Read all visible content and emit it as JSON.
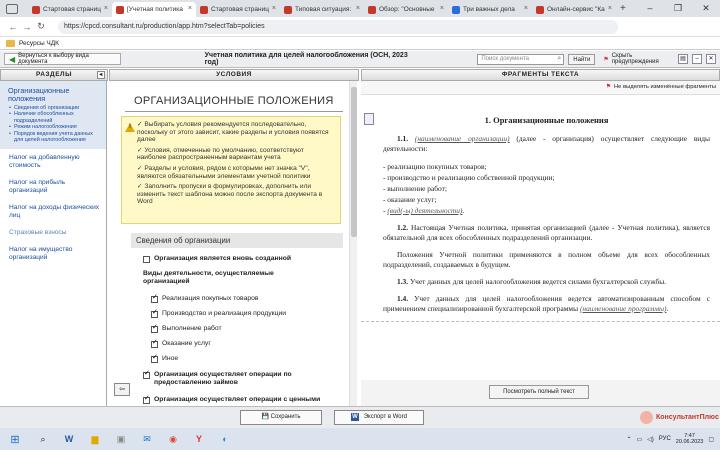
{
  "browser": {
    "tabs": [
      {
        "title": "Стартовая страниц",
        "color": "#c0392b",
        "active": false
      },
      {
        "title": "[Учетная политика",
        "color": "#c0392b",
        "active": true
      },
      {
        "title": "Стартовая страниц",
        "color": "#c0392b",
        "active": false
      },
      {
        "title": "Типовая ситуация:",
        "color": "#c0392b",
        "active": false
      },
      {
        "title": "Обзор: \"Основные",
        "color": "#c0392b",
        "active": false
      },
      {
        "title": "Три важных дела",
        "color": "#2b6cd6",
        "active": false
      },
      {
        "title": "Онлайн-сервис \"Ка",
        "color": "#c0392b",
        "active": false
      }
    ],
    "new_tab": "+",
    "url": "https://cpcd.consultant.ru/production/app.htm?selectTab=policies",
    "bookmark_folder": "Ресурсы ЧДК"
  },
  "toolbar": {
    "back_button": "Вернуться к выбору вида документа",
    "doc_title": "Учетная политика для целей налогообложения (ОСН, 2023 год)",
    "search_placeholder": "Поиск документа",
    "find_button": "Найти",
    "hide_warnings": "Скрыть предупреждения"
  },
  "panels": {
    "left_header": "РАЗДЕЛЫ",
    "mid_header": "УСЛОВИЯ",
    "right_header": "ФРАГМЕНТЫ ТЕКСТА"
  },
  "sections": {
    "selected": "Организационные положения",
    "subitems": [
      "Сведения об организации",
      "Наличие обособленных подразделений",
      "Режим налогообложения",
      "Порядок ведения учета данных для целей налогообложения"
    ],
    "items": [
      {
        "label": "Налог на добавленную стоимость",
        "gray": false
      },
      {
        "label": "Налог на прибыль организаций",
        "gray": false
      },
      {
        "label": "Налог на доходы физических лиц",
        "gray": false
      },
      {
        "label": "Страховые взносы",
        "gray": true
      },
      {
        "label": "Налог на имущество организаций",
        "gray": false
      }
    ]
  },
  "conditions": {
    "title": "ОРГАНИЗАЦИОННЫЕ ПОЛОЖЕНИЯ",
    "note": [
      "✓ Выбирать условия рекомендуется последовательно, поскольку от этого зависит, какие разделы и условия появятся далее",
      "✓ Условия, отмеченные по умолчанию, соответствуют наиболее распространенным вариантам учета",
      "✓ Разделы и условия, рядом с которыми нет значка \"V\", являются обязательными элементами учетной политики",
      "✓ Заполнить пропуски в формулировках, дополнить или изменить текст шаблона можно после экспорта документа в Word"
    ],
    "section_title": "Сведения об организации",
    "new_org": "Организация является вновь созданной",
    "activities_label": "Виды деятельности, осуществляемые организацией",
    "activities": [
      "Реализация покупных товаров",
      "Производство и реализация продукции",
      "Выполнение работ",
      "Оказание услуг",
      "Иное"
    ],
    "loans": "Организация осуществляет операции по предоставлению займов",
    "securities": "Организация осуществляет операции с ценными"
  },
  "fragment": {
    "show_changes": "Не выделять изменённые фрагменты",
    "heading": "1.  Организационные положения",
    "p1_num": "1.1.",
    "p1_placeholder": "(наименование организации)",
    "p1_text": " (далее - организация) осуществляет следующие виды деятельности:",
    "list": [
      "-  реализацию покупных товаров;",
      "-  производство и реализацию собственной продукции;",
      "-  выполнение работ;",
      "-  оказание услуг;"
    ],
    "list_last_placeholder": "(вид(-ы) деятельности)",
    "p2_num": "1.2.",
    "p2_text": " Настоящая Учетная политика, принятая организацией (далее - Учетная политика), является обязательной для всех обособленных подразделений организации.",
    "p3_text": "Положения Учетной политики  применяются в полном объеме для  всех обособленных подразделений, создаваемых в будущем.",
    "p4_num": "1.3.",
    "p4_text": " Учет данных для целей налогообложения ведется силами бухгалтерской службы.",
    "p5_num": "1.4.",
    "p5_text": " Учет данных для целей налогообложения ведется автоматизированным способом с применением специализированной бухгалтерской программы ",
    "p5_placeholder": "(наименование программы)",
    "view_all": "Посмотреть полный текст"
  },
  "bottom": {
    "save": "Сохранить",
    "export": "Экспорт в Word",
    "brand": "КонсультантПлюс"
  },
  "taskbar": {
    "lang": "РУС",
    "time": "7:47",
    "date": "20.06.2023"
  }
}
